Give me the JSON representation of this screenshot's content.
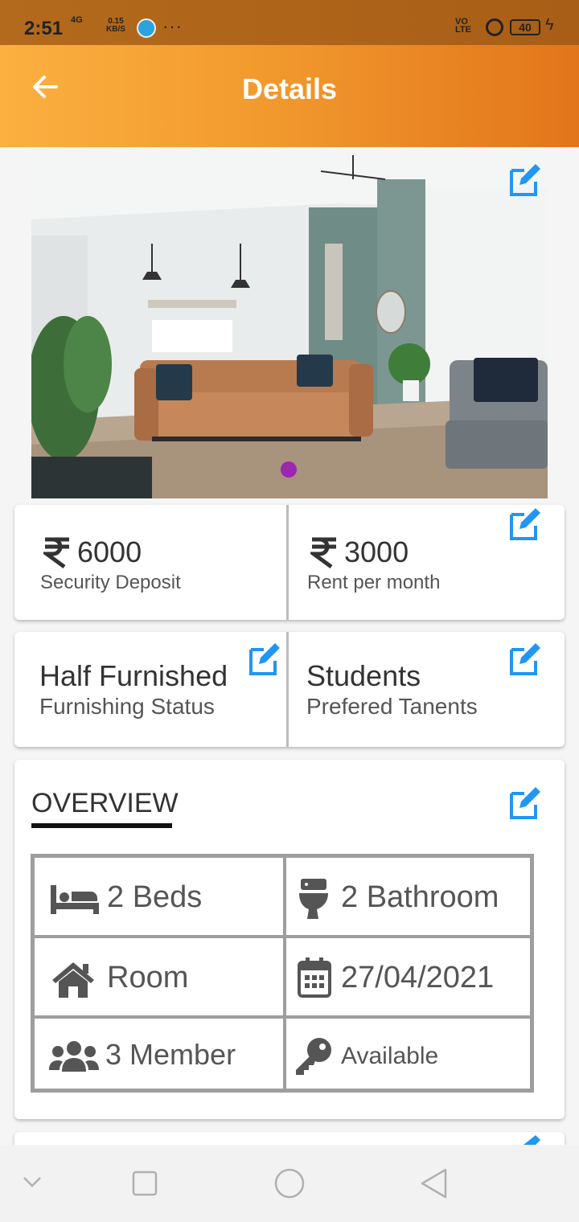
{
  "status_bar": {
    "time": "2:51",
    "network": "4G",
    "speed_value": "0.15",
    "speed_unit": "KB/S",
    "more": "···",
    "volte_top": "VO",
    "volte_bottom": "LTE",
    "battery": "40"
  },
  "app_bar": {
    "title": "Details"
  },
  "pricing": {
    "deposit_amount": "6000",
    "deposit_label": "Security Deposit",
    "rent_amount": "3000",
    "rent_label": "Rent per month"
  },
  "details": {
    "furnishing_value": "Half Furnished",
    "furnishing_label": "Furnishing Status",
    "tenants_value": "Students",
    "tenants_label": "Prefered Tanents"
  },
  "overview": {
    "title": "OVERVIEW",
    "beds": "2 Beds",
    "bathroom": "2 Bathroom",
    "type": "Room",
    "date": "27/04/2021",
    "members": "3 Member",
    "availability": "Available"
  },
  "colors": {
    "accent_orange": "#f29a2e",
    "edit_blue": "#2196f3",
    "carousel_dot": "#9c27b0"
  },
  "icons": [
    "back-arrow-icon",
    "edit-icon",
    "rupee-icon",
    "bed-icon",
    "toilet-icon",
    "home-icon",
    "calendar-icon",
    "group-icon",
    "key-icon"
  ]
}
